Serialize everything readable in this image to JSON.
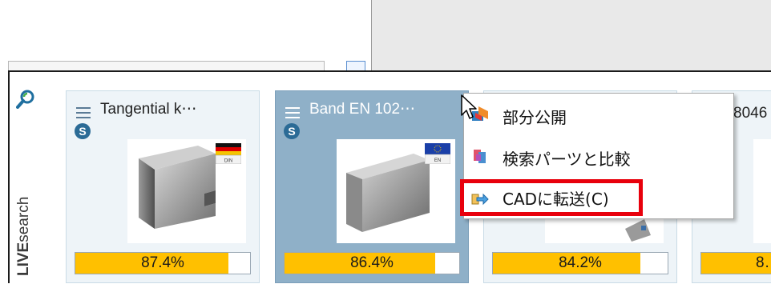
{
  "side_panel": {
    "brand_bold": "LIVE",
    "brand_rest": "search"
  },
  "cards": [
    {
      "title": "Tangential k⋯",
      "badge": "S",
      "flag": "DIN",
      "match": "87.4%",
      "match_fraction": 0.874
    },
    {
      "title": "Band EN 102⋯",
      "badge": "S",
      "flag": "EN",
      "match": "86.4%",
      "match_fraction": 0.864
    },
    {
      "title": "",
      "badge": "",
      "flag": "",
      "match": "84.2%",
      "match_fraction": 0.842
    },
    {
      "title": "8046",
      "badge": "",
      "flag": "",
      "match": "8…",
      "match_fraction": 0.9
    }
  ],
  "context_menu": {
    "items": [
      {
        "label": "部分公開",
        "icon": "partial-publish-icon"
      },
      {
        "label": "検索パーツと比較",
        "icon": "compare-parts-icon"
      },
      {
        "label": "CADに転送(C)",
        "icon": "transfer-to-cad-icon",
        "highlighted": true
      }
    ]
  },
  "colors": {
    "match_fill": "#ffc000",
    "highlight": "#e8000c",
    "selected_card": "#8fb0c8"
  }
}
